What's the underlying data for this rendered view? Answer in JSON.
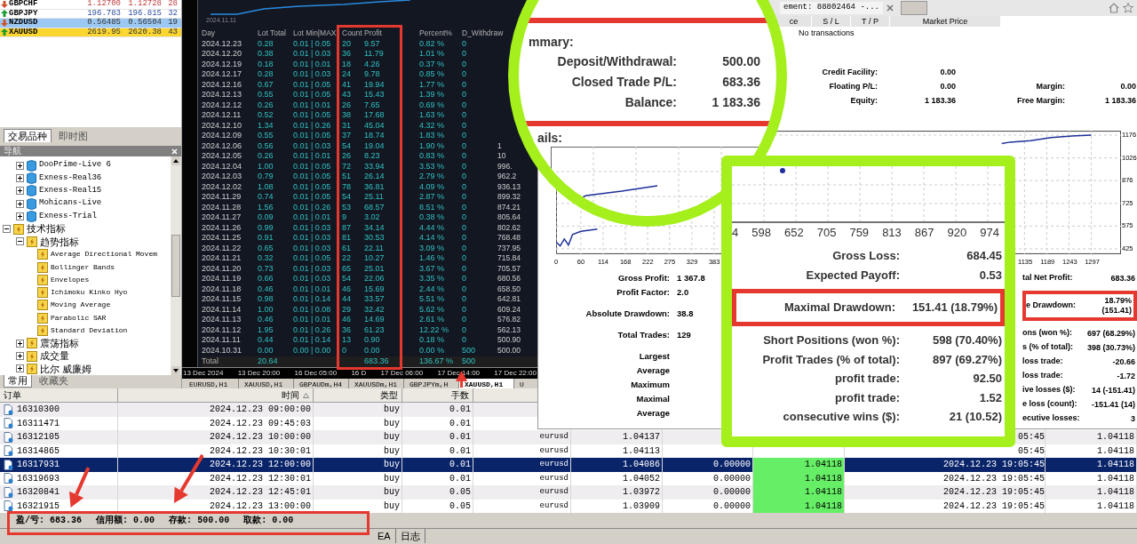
{
  "market_watch": {
    "rows": [
      {
        "symbol": "GBPCHF",
        "bid": "1.12700",
        "ask": "1.12728",
        "spread": "28",
        "rising": false
      },
      {
        "symbol": "GBPJPY",
        "bid": "196.783",
        "ask": "196.815",
        "spread": "32",
        "rising": true
      },
      {
        "symbol": "NZDUSD",
        "bid": "0.56485",
        "ask": "0.56504",
        "spread": "19",
        "rising": false,
        "color": "#9cc8f4"
      },
      {
        "symbol": "XAUUSD",
        "bid": "2619.95",
        "ask": "2620.38",
        "spread": "43",
        "rising": true,
        "color": "#fbd630"
      }
    ],
    "tabs": [
      {
        "label": "交易品种",
        "selected": true
      },
      {
        "label": "即时图",
        "selected": false
      }
    ]
  },
  "navigator": {
    "title": "导航",
    "servers": [
      {
        "label": "DooPrime-Live 6",
        "kind": "server",
        "expanded": false
      },
      {
        "label": "Exness-Real36",
        "kind": "server",
        "expanded": false
      },
      {
        "label": "Exness-Real15",
        "kind": "server",
        "expanded": false
      },
      {
        "label": "Mohicans-Live",
        "kind": "server",
        "expanded": false
      },
      {
        "label": "Exness-Trial",
        "kind": "server",
        "expanded": false
      }
    ],
    "tree": [
      {
        "label": "技术指标",
        "kind": "indicator",
        "expanded": true,
        "children": [
          {
            "label": "趋势指标",
            "kind": "indicator",
            "expanded": true,
            "children": [
              {
                "label": "Average Directional Movem",
                "kind": "indicator"
              },
              {
                "label": "Bollinger Bands",
                "kind": "indicator"
              },
              {
                "label": "Envelopes",
                "kind": "indicator"
              },
              {
                "label": "Ichimoku Kinko Hyo",
                "kind": "indicator"
              },
              {
                "label": "Moving Average",
                "kind": "indicator"
              },
              {
                "label": "Parabolic SAR",
                "kind": "indicator"
              },
              {
                "label": "Standard Deviation",
                "kind": "indicator"
              }
            ]
          },
          {
            "label": "震荡指标",
            "kind": "indicator",
            "expanded": false
          },
          {
            "label": "成交量",
            "kind": "indicator",
            "expanded": false
          },
          {
            "label": "比尔 威廉姆",
            "kind": "indicator",
            "expanded": false
          }
        ]
      }
    ],
    "tabs": [
      {
        "label": "常用",
        "selected": true
      },
      {
        "label": "收藏夹",
        "selected": false
      }
    ]
  },
  "chart": {
    "date_label": "2024.11.11",
    "columns": [
      "Day",
      "Lot Total",
      "Lot Min|MAX",
      "Count",
      "Profit",
      "Percent%",
      "D_Withdraw"
    ],
    "rows": [
      [
        "2024.12.23",
        "0.28",
        "0.01 | 0.05",
        "20",
        "9.57",
        "0.82 %",
        "0"
      ],
      [
        "2024.12.20",
        "0.38",
        "0.01 | 0.03",
        "36",
        "11.79",
        "1.01 %",
        "0"
      ],
      [
        "2024.12.19",
        "0.18",
        "0.01 | 0.01",
        "18",
        "4.26",
        "0.37 %",
        "0"
      ],
      [
        "2024.12.17",
        "0.28",
        "0.01 | 0.03",
        "24",
        "9.78",
        "0.85 %",
        "0"
      ],
      [
        "2024.12.16",
        "0.67",
        "0.01 | 0.05",
        "41",
        "19.94",
        "1.77 %",
        "0"
      ],
      [
        "2024.12.13",
        "0.55",
        "0.01 | 0.05",
        "43",
        "15.43",
        "1.39 %",
        "0"
      ],
      [
        "2024.12.12",
        "0.26",
        "0.01 | 0.01",
        "26",
        "7.65",
        "0.69 %",
        "0"
      ],
      [
        "2024.12.11",
        "0.52",
        "0.01 | 0.05",
        "38",
        "17.68",
        "1.63 %",
        "0"
      ],
      [
        "2024.12.10",
        "1.34",
        "0.01 | 0.26",
        "31",
        "45.04",
        "4.32 %",
        "0"
      ],
      [
        "2024.12.09",
        "0.55",
        "0.01 | 0.05",
        "37",
        "18.74",
        "1.83 %",
        "0"
      ],
      [
        "2024.12.06",
        "0.56",
        "0.01 | 0.03",
        "54",
        "19.04",
        "1.90 %",
        "0",
        "1"
      ],
      [
        "2024.12.05",
        "0.26",
        "0.01 | 0.01",
        "26",
        "8.23",
        "0.83 %",
        "0",
        "10"
      ],
      [
        "2024.12.04",
        "1.00",
        "0.01 | 0.05",
        "72",
        "33.94",
        "3.53 %",
        "0",
        "996."
      ],
      [
        "2024.12.03",
        "0.79",
        "0.01 | 0.05",
        "51",
        "26.14",
        "2.79 %",
        "0",
        "962.2"
      ],
      [
        "2024.12.02",
        "1.08",
        "0.01 | 0.05",
        "78",
        "36.81",
        "4.09 %",
        "0",
        "936.13"
      ],
      [
        "2024.11.29",
        "0.74",
        "0.01 | 0.05",
        "54",
        "25.11",
        "2.87 %",
        "0",
        "899.32"
      ],
      [
        "2024.11.28",
        "1.56",
        "0.01 | 0.26",
        "53",
        "68.57",
        "8.51 %",
        "0",
        "874.21"
      ],
      [
        "2024.11.27",
        "0.09",
        "0.01 | 0.01",
        "9",
        "3.02",
        "0.38 %",
        "0",
        "805.64"
      ],
      [
        "2024.11.26",
        "0.99",
        "0.01 | 0.03",
        "87",
        "34.14",
        "4.44 %",
        "0",
        "802.62"
      ],
      [
        "2024.11.25",
        "0.91",
        "0.01 | 0.03",
        "81",
        "30.53",
        "4.14 %",
        "0",
        "768.48"
      ],
      [
        "2024.11.22",
        "0.65",
        "0.01 | 0.03",
        "61",
        "22.11",
        "3.09 %",
        "0",
        "737.95"
      ],
      [
        "2024.11.21",
        "0.32",
        "0.01 | 0.05",
        "22",
        "10.27",
        "1.46 %",
        "0",
        "715.84"
      ],
      [
        "2024.11.20",
        "0.73",
        "0.01 | 0.03",
        "65",
        "25.01",
        "3.67 %",
        "0",
        "705.57"
      ],
      [
        "2024.11.19",
        "0.66",
        "0.01 | 0.03",
        "54",
        "22.06",
        "3.35 %",
        "0",
        "680.56"
      ],
      [
        "2024.11.18",
        "0.46",
        "0.01 | 0.01",
        "46",
        "15.69",
        "2.44 %",
        "0",
        "658.50"
      ],
      [
        "2024.11.15",
        "0.98",
        "0.01 | 0.14",
        "44",
        "33.57",
        "5.51 %",
        "0",
        "642.81"
      ],
      [
        "2024.11.14",
        "1.00",
        "0.01 | 0.08",
        "29",
        "32.42",
        "5.62 %",
        "0",
        "609.24"
      ],
      [
        "2024.11.13",
        "0.46",
        "0.01 | 0.01",
        "46",
        "14.69",
        "2.61 %",
        "0",
        "576.82"
      ],
      [
        "2024.11.12",
        "1.95",
        "0.01 | 0.26",
        "36",
        "61.23",
        "12.22 %",
        "0",
        "562.13"
      ],
      [
        "2024.11.11",
        "0.44",
        "0.01 | 0.14",
        "13",
        "0.90",
        "0.18 %",
        "0",
        "500.90"
      ],
      [
        "2024.10.31",
        "0.00",
        "0.00 | 0.00",
        "0",
        "0.00",
        "0.00 %",
        "500",
        "500.00"
      ]
    ],
    "total": {
      "label": "Total",
      "lot_total": "20.64",
      "profit": "683.36",
      "percent": "136.67 %",
      "withdraw": "500"
    },
    "time_axis": [
      "13 Dec 2024",
      "13 Dec 20:00",
      "16 Dec 05:00",
      "16 D",
      "17 Dec 06:00",
      "17 Dec 14:00",
      "17 Dec 22:00"
    ],
    "tabs": [
      {
        "label": "EURUSD,H1",
        "selected": false
      },
      {
        "label": "XAUUSD,H1",
        "selected": false
      },
      {
        "label": "GBPAUDm,H4",
        "selected": false
      },
      {
        "label": "XAUUSDm,H1",
        "selected": false
      },
      {
        "label": "GBPJPYm,H",
        "selected": false
      },
      {
        "label": "XAUUSD,H1",
        "selected": true
      },
      {
        "label": "U",
        "selected": false
      }
    ]
  },
  "report": {
    "tab_title": "ement: 88802464 -...",
    "columns": [
      "ce",
      "S / L",
      "T / P",
      "Market Price"
    ],
    "empty_text": "No transactions",
    "account": [
      {
        "label": "Credit Facility:",
        "value": "0.00"
      },
      {
        "label": "Floating P/L:",
        "value": "0.00",
        "label_2": "Margin:",
        "value_2": "0.00"
      },
      {
        "label": "Equity:",
        "value": "1 183.36",
        "label_2": "Free Margin:",
        "value_2": "1 183.36"
      }
    ],
    "chart_data": {
      "type": "line",
      "grid": true,
      "xlim": [
        0,
        1369
      ],
      "ylim": [
        390,
        1205
      ],
      "x": [
        0,
        10,
        20,
        30,
        40,
        60,
        100,
        200,
        300,
        400,
        600,
        800,
        1000,
        1060,
        1080,
        1100,
        1150,
        1200,
        1250,
        1297
      ],
      "series": [
        {
          "color": "#1f2f9a",
          "values": [
            470,
            445,
            490,
            450,
            520,
            540,
            555,
            null,
            null,
            null,
            null,
            null,
            null,
            null,
            1120,
            1130,
            1140,
            1160,
            1170,
            1176
          ]
        }
      ],
      "xticks": [
        0,
        60,
        114,
        168,
        222,
        275,
        329,
        383,
        1135,
        1189,
        1243,
        1297
      ],
      "yticks": [
        1176,
        1026,
        876,
        725,
        575,
        425
      ]
    },
    "stats_left": [
      [
        {
          "label": "Gross Profit:",
          "value": "1 367.8"
        },
        {
          "label": "Profit Factor:",
          "value": "2.0"
        }
      ],
      [
        {
          "label": "Absolute Drawdown:",
          "value": "38.8"
        }
      ],
      [
        {
          "label": "Total Trades:",
          "value": "129"
        }
      ],
      [
        {
          "label": "Largest"
        },
        {
          "label": "Average"
        },
        {
          "label": "Maximum"
        },
        {
          "label": "Maximal"
        },
        {
          "label": "Average"
        }
      ]
    ],
    "stats_right": [
      [
        {
          "label": "tal Net Profit:",
          "value": "683.36",
          "highlighted": false
        }
      ],
      [
        {
          "label": "e Drawdown:",
          "value": "18.79%",
          "value_2": "(151.41)",
          "highlighted": true
        }
      ],
      [
        {
          "label": "ons (won %):",
          "value": "697 (68.29%)",
          "highlighted": false
        },
        {
          "label": "s (% of total):",
          "value": "398 (30.73%)",
          "highlighted": false
        },
        {
          "label": "loss trade:",
          "value": "-20.66",
          "highlighted": false
        },
        {
          "label": "loss trade:",
          "value": "-1.72",
          "highlighted": false
        },
        {
          "label": "ive losses ($):",
          "value": "14 (-151.41)",
          "highlighted": false
        },
        {
          "label": "e loss (count):",
          "value": "-151.41 (14)",
          "highlighted": false
        },
        {
          "label": "ecutive losses:",
          "value": "3",
          "highlighted": false
        }
      ]
    ]
  },
  "magnifier_circle": {
    "heading": "mmary:",
    "rows": [
      {
        "label": "Deposit/Withdrawal:",
        "value": "500.00"
      },
      {
        "label": "Closed Trade P/L:",
        "value": "683.36"
      },
      {
        "label": "Balance:",
        "value": "1 183.36"
      }
    ],
    "footer": "ails:"
  },
  "magnifier_box": {
    "x_ticks": [
      "4",
      "598",
      "652",
      "705",
      "759",
      "813",
      "867",
      "920",
      "974"
    ],
    "stats": [
      {
        "label": "Gross Loss:",
        "value": "684.45",
        "highlighted": false
      },
      {
        "label": "Expected Payoff:",
        "value": "0.53",
        "highlighted": false
      },
      {
        "label": "Maximal Drawdown:",
        "value": "151.41 (18.79%)",
        "highlighted": true
      },
      {
        "label": "Short Positions (won %):",
        "value": "598 (70.40%)",
        "highlighted": false
      },
      {
        "label": "Profit Trades (% of total):",
        "value": "897 (69.27%)",
        "highlighted": false
      },
      {
        "label": "profit trade:",
        "value": "92.50",
        "highlighted": false
      },
      {
        "label": "profit trade:",
        "value": "1.52",
        "highlighted": false
      },
      {
        "label": "consecutive wins ($):",
        "value": "21 (10.52)",
        "highlighted": false
      }
    ]
  },
  "history": {
    "columns": [
      "订单",
      "时间",
      "类型",
      "手数"
    ],
    "rows": [
      {
        "order": "16310300",
        "time": "2024.12.23 09:00:00",
        "type": "buy",
        "lots": "0.01",
        "selected": false
      },
      {
        "order": "16311471",
        "time": "2024.12.23 09:45:03",
        "type": "buy",
        "lots": "0.01",
        "selected": false
      },
      {
        "order": "16312105",
        "time": "2024.12.23 10:00:00",
        "type": "buy",
        "lots": "0.01",
        "symbol": "eurusd",
        "price": "1.04137",
        "close_time": "05:45",
        "close_price": "1.04118",
        "selected": false
      },
      {
        "order": "16314865",
        "time": "2024.12.23 10:30:01",
        "type": "buy",
        "lots": "0.01",
        "symbol": "eurusd",
        "price": "1.04113",
        "close_time": "05:45",
        "close_price": "1.04118",
        "selected": false
      },
      {
        "order": "16317931",
        "time": "2024.12.23 12:00:00",
        "type": "buy",
        "lots": "0.01",
        "symbol": "eurusd",
        "price": "1.04086",
        "sl": "0.00000",
        "tp": "1.04118",
        "close_time": "2024.12.23 19:05:45",
        "close_price": "1.04118",
        "selected": true
      },
      {
        "order": "16319693",
        "time": "2024.12.23 12:30:01",
        "type": "buy",
        "lots": "0.01",
        "symbol": "eurusd",
        "price": "1.04052",
        "sl": "0.00000",
        "tp": "1.04118",
        "close_time": "2024.12.23 19:05:45",
        "close_price": "1.04118",
        "selected": false
      },
      {
        "order": "16320841",
        "time": "2024.12.23 12:45:01",
        "type": "buy",
        "lots": "0.05",
        "symbol": "eurusd",
        "price": "1.03972",
        "sl": "0.00000",
        "tp": "1.04118",
        "close_time": "2024.12.23 19:05:45",
        "close_price": "1.04118",
        "selected": false
      },
      {
        "order": "16321915",
        "time": "2024.12.23 13:00:00",
        "type": "buy",
        "lots": "0.05",
        "symbol": "eurusd",
        "price": "1.03909",
        "sl": "0.00000",
        "tp": "1.04118",
        "close_time": "2024.12.23 19:05:45",
        "close_price": "1.04118",
        "selected": false
      }
    ],
    "summary": [
      {
        "label": "盈/亏:",
        "value": "683.36"
      },
      {
        "label": "信用额:",
        "value": "0.00"
      },
      {
        "label": "存款:",
        "value": "500.00"
      },
      {
        "label": "取款:",
        "value": "0.00"
      }
    ],
    "tabs": [
      {
        "label": "EA",
        "selected": false
      },
      {
        "label": "日志",
        "selected": false
      }
    ]
  }
}
